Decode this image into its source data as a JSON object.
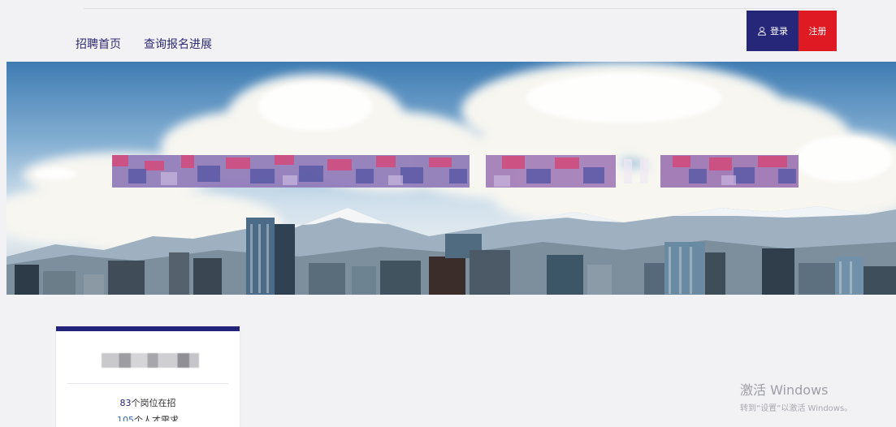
{
  "nav": {
    "links": [
      {
        "label": "招聘首页"
      },
      {
        "label": "查询报名进展"
      }
    ],
    "login_label": "登录",
    "register_label": "注册"
  },
  "banner": {
    "title": "████████████ “████” ████"
  },
  "card": {
    "jobs_count": "83",
    "jobs_suffix": "个岗位在招",
    "talents_count": "105",
    "talents_suffix": "个人才需求"
  },
  "watermark": {
    "title": "激活 Windows",
    "subtitle": "转到“设置”以激活 Windows。"
  },
  "colors": {
    "brand_navy": "#27277a",
    "brand_red": "#e01a22"
  }
}
